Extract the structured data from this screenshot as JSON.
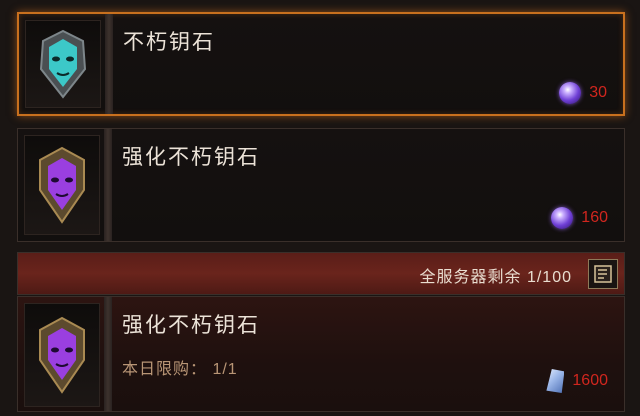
{
  "items": [
    {
      "name": "不朽钥石",
      "price": "30",
      "currency_icon": "purple-orb-icon",
      "mask_color": "#3cc8c8"
    },
    {
      "name": "强化不朽钥石",
      "price": "160",
      "currency_icon": "purple-orb-icon",
      "mask_color": "#9a3fe0"
    },
    {
      "name": "强化不朽钥石",
      "limit": "本日限购： 1/1",
      "price": "1600",
      "currency_icon": "crystal-icon",
      "mask_color": "#9a3fe0"
    }
  ],
  "server_bar": {
    "text": "全服务器剩余 1/100",
    "icon": "scroll-icon"
  },
  "colors": {
    "price_red": "#d0261e",
    "selected_border": "#c8701e",
    "server_bar_bg": "#5a1e18"
  }
}
